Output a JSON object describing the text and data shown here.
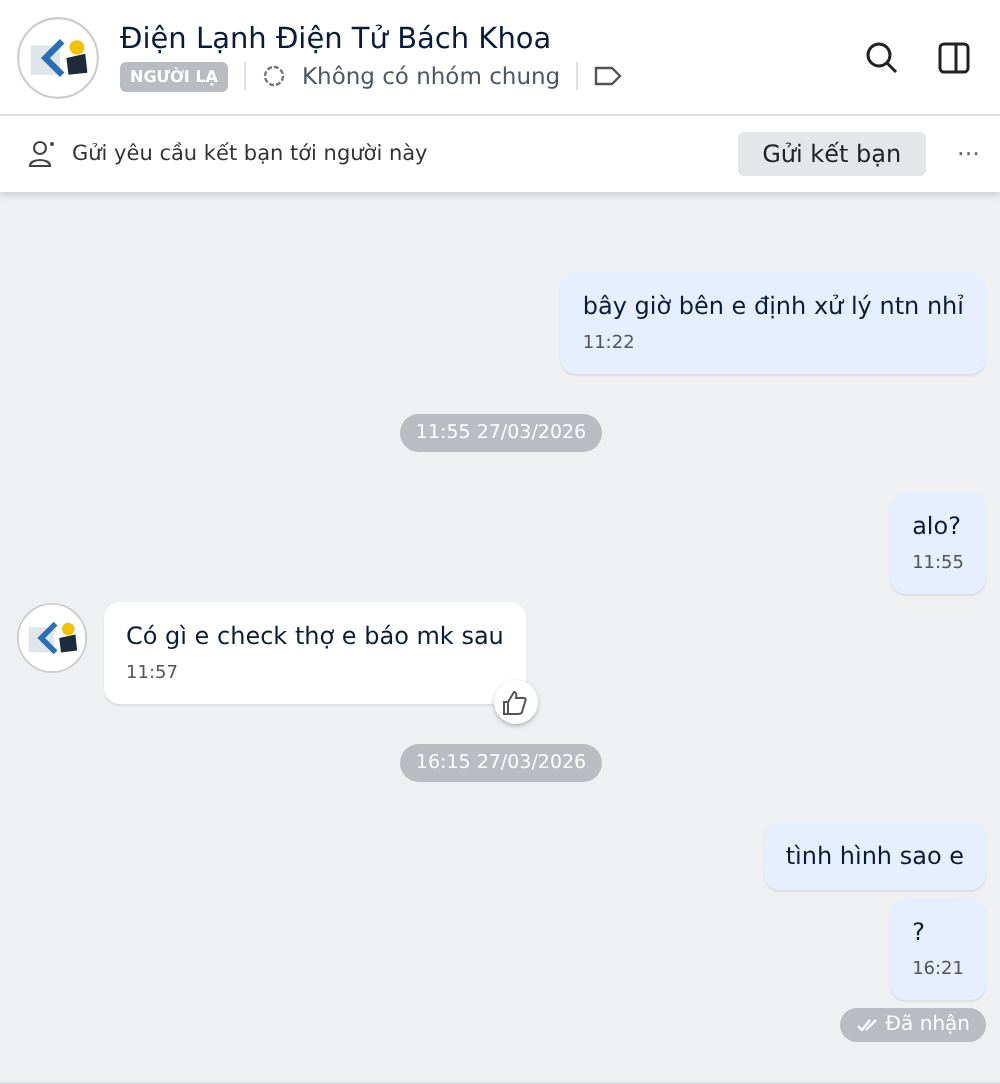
{
  "header": {
    "name": "Điện Lạnh Điện Tử Bách Khoa",
    "badge": "NGƯỜI LẠ",
    "groups": "Không có nhóm chung"
  },
  "friend_bar": {
    "text": "Gửi yêu cầu kết bạn tới người này",
    "button": "Gửi kết bạn",
    "more": "···"
  },
  "messages": [
    {
      "kind": "sent",
      "text": "bây giờ bên e định xử lý ntn nhỉ",
      "time": "11:22"
    },
    {
      "kind": "separator",
      "text": "11:55 27/03/2026"
    },
    {
      "kind": "sent",
      "text": "alo?",
      "time": "11:55"
    },
    {
      "kind": "received",
      "text": "Có gì e check thợ e báo mk sau",
      "time": "11:57",
      "like": true
    },
    {
      "kind": "separator",
      "text": "16:15 27/03/2026"
    },
    {
      "kind": "sent",
      "text": "tình hình sao e"
    },
    {
      "kind": "sent",
      "text": "?",
      "time": "16:21"
    },
    {
      "kind": "status",
      "text": "Đã nhận"
    }
  ]
}
